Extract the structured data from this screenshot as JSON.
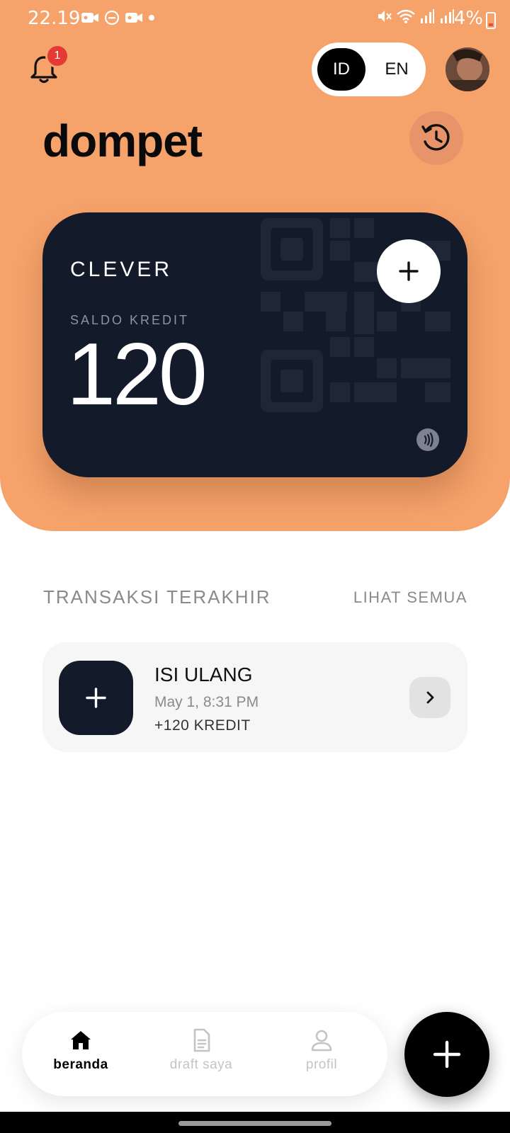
{
  "status_bar": {
    "time": "22.19",
    "battery": "4%"
  },
  "notifications": {
    "badge_count": "1"
  },
  "language": {
    "options": [
      "ID",
      "EN"
    ],
    "selected": "ID"
  },
  "header": {
    "title": "dompet"
  },
  "wallet_card": {
    "name": "CLEVER",
    "balance_label": "SALDO KREDIT",
    "balance": "120"
  },
  "transactions": {
    "section_title": "TRANSAKSI TERAKHIR",
    "see_all": "LIHAT SEMUA",
    "items": [
      {
        "title": "ISI ULANG",
        "date": "May 1, 8:31 PM",
        "amount": "+120 KREDIT"
      }
    ]
  },
  "bottom_nav": {
    "items": [
      {
        "label": "beranda",
        "icon": "home-icon",
        "active": true
      },
      {
        "label": "draft saya",
        "icon": "document-icon",
        "active": false
      },
      {
        "label": "profil",
        "icon": "user-icon",
        "active": false
      }
    ]
  },
  "colors": {
    "accent": "#f5a26b",
    "card": "#131a2a",
    "badge": "#e53935"
  }
}
